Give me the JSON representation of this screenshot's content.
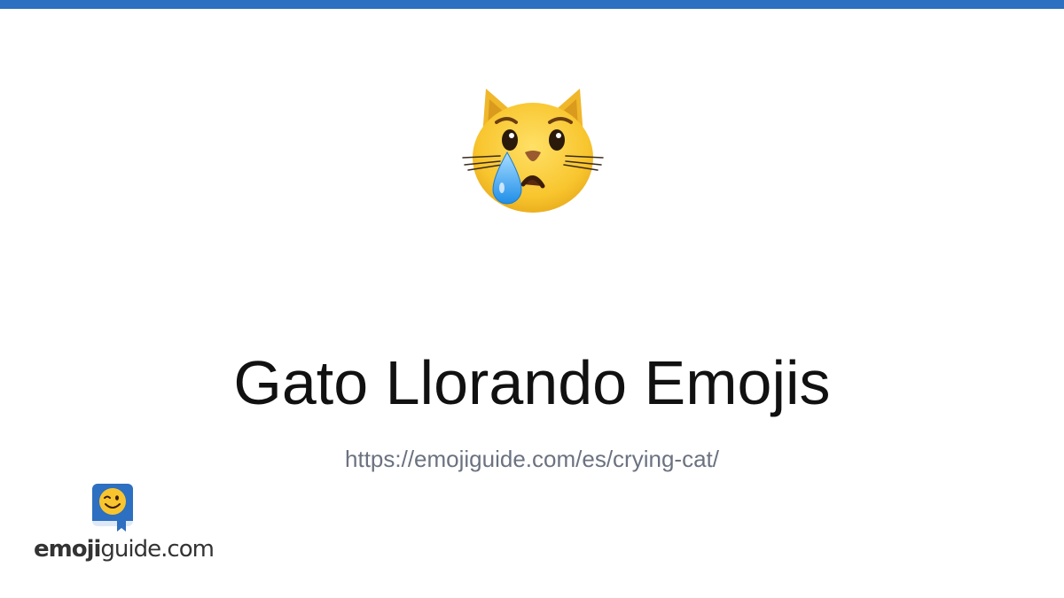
{
  "colors": {
    "top_bar": "#2d6fc0",
    "title": "#111111",
    "url": "#6b7280"
  },
  "hero": {
    "icon": "crying-cat-icon"
  },
  "title": "Gato Llorando Emojis",
  "url": "https://emojiguide.com/es/crying-cat/",
  "logo": {
    "icon": "winking-face-book-icon",
    "text_bold": "emoji",
    "text_regular": "guide.com"
  }
}
